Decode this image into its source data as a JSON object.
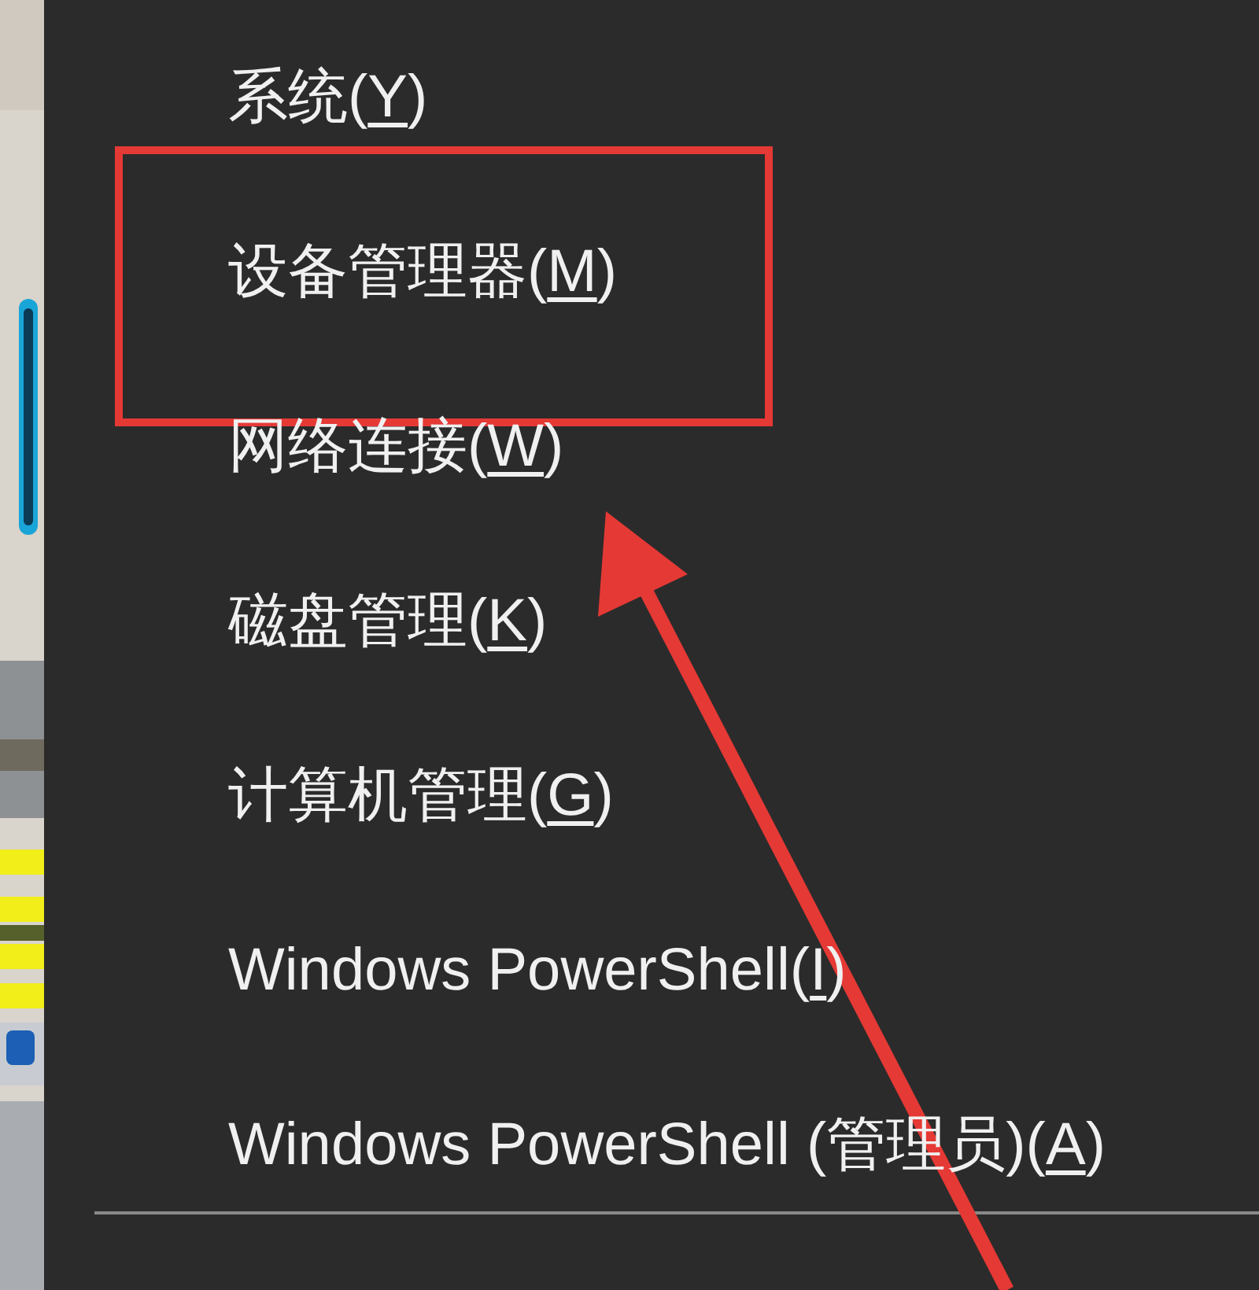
{
  "menu": {
    "items": [
      {
        "text": "系统(Y)"
      },
      {
        "text": "设备管理器(M)"
      },
      {
        "text": "网络连接(W)"
      },
      {
        "text": "磁盘管理(K)"
      },
      {
        "text": "计算机管理(G)"
      },
      {
        "text": "Windows PowerShell(I)"
      },
      {
        "text": "Windows PowerShell (管理员)(A)"
      }
    ]
  }
}
